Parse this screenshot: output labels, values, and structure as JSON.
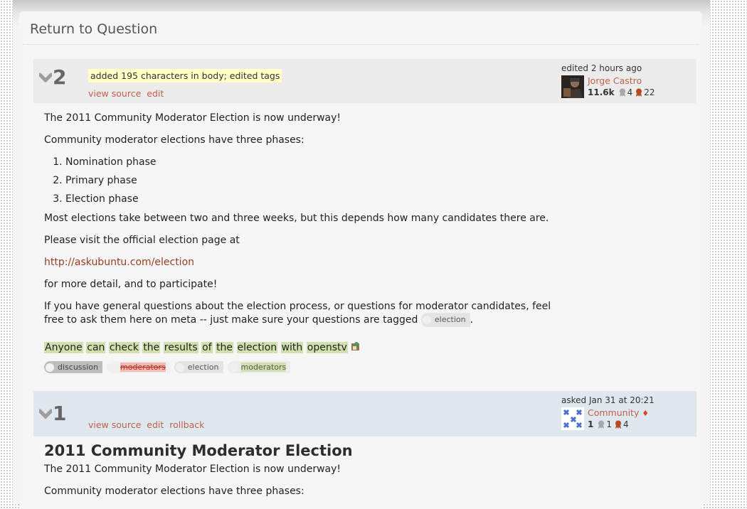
{
  "header": {
    "return_link": "Return to Question"
  },
  "revisions": [
    {
      "number": "2",
      "comment": "added 195 characters in body; edited tags",
      "actions": [
        "view source",
        "edit"
      ],
      "signature": {
        "action_time": "edited 2 hours ago",
        "user_name": "Jorge Castro",
        "reputation": "11.6k",
        "silver_badges": "4",
        "bronze_badges": "22"
      },
      "body": {
        "intro": "The 2011 Community Moderator Election is now underway!",
        "phases_intro": "Community moderator elections have three phases:",
        "phases": [
          "Nomination phase",
          "Primary phase",
          "Election phase"
        ],
        "duration": "Most elections take between two and three weeks, but this depends how many candidates there are.",
        "visit": "Please visit the official election page at",
        "url": "http://askubuntu.com/election",
        "detail": "for more detail, and to participate!",
        "questions_line1": "If you have general questions about the election process, or questions for moderator candidates, feel",
        "questions_line2": "free to ask them here on meta -- just make sure your questions are tagged",
        "inline_tag": "election",
        "period": ".",
        "added_words": [
          "Anyone",
          "can",
          "check",
          "the",
          "results",
          "of",
          "the",
          "election",
          "with",
          "openstv"
        ]
      },
      "tags": [
        {
          "name": "discussion",
          "state": "current"
        },
        {
          "name": "moderators",
          "state": "removed"
        },
        {
          "name": "election",
          "state": "unchanged"
        },
        {
          "name": "moderators",
          "state": "added"
        }
      ]
    },
    {
      "number": "1",
      "actions": [
        "view source",
        "edit",
        "rollback"
      ],
      "signature": {
        "action_time": "asked Jan 31 at 20:21",
        "user_name": "Community",
        "moderator_mark": "♦",
        "reputation": "1",
        "silver_badges": "1",
        "bronze_badges": "4"
      },
      "title": "2011 Community Moderator Election",
      "body": {
        "intro": "The 2011 Community Moderator Election is now underway!",
        "phases_intro": "Community moderator elections have three phases:"
      }
    }
  ]
}
